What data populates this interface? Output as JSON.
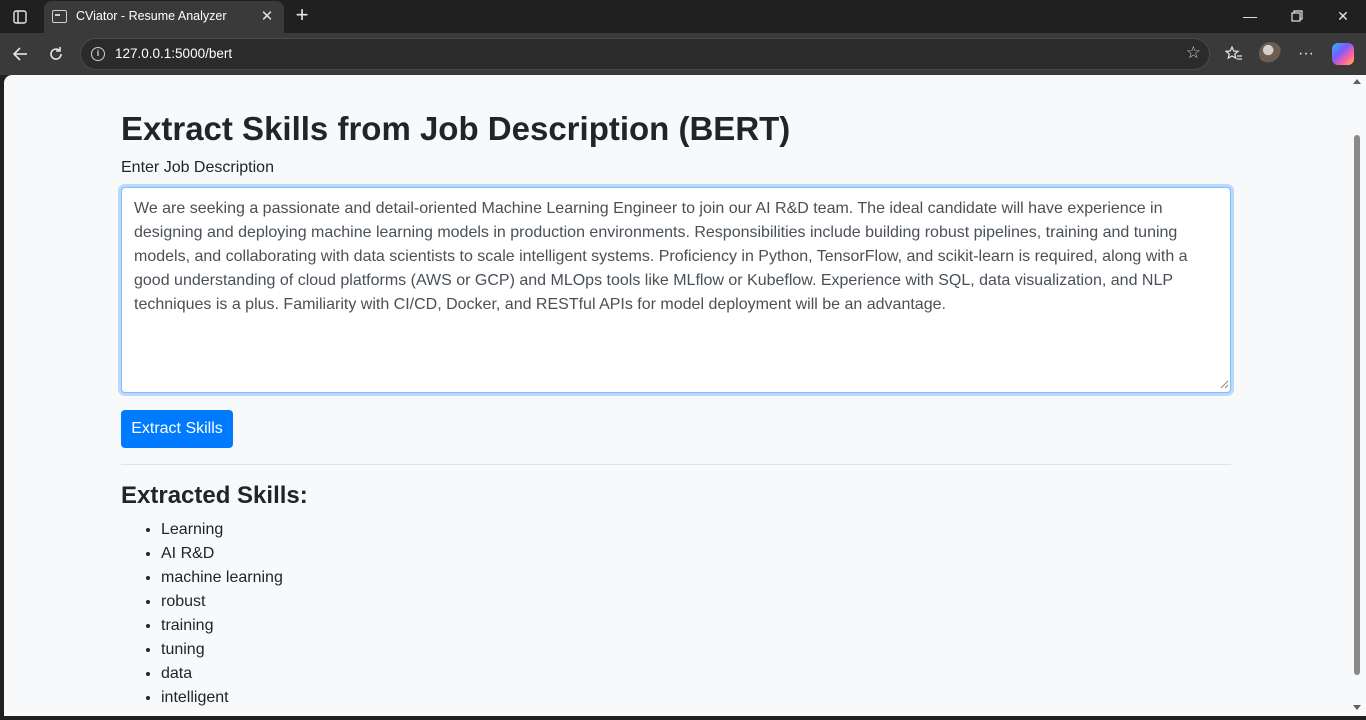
{
  "browser": {
    "tab_title": "CViator - Resume Analyzer",
    "url": "127.0.0.1:5000/bert",
    "new_tab_symbol": "+",
    "icons": [
      "tab-actions-icon",
      "page-favicon",
      "close-icon",
      "plus-icon",
      "minimize-icon",
      "restore-icon",
      "close-window-icon",
      "back-arrow-icon",
      "refresh-icon",
      "site-info-icon",
      "star-icon",
      "favorites-icon",
      "profile-avatar",
      "more-icon",
      "copilot-icon"
    ]
  },
  "page": {
    "heading": "Extract Skills from Job Description (BERT)",
    "input_label": "Enter Job Description",
    "job_description": "We are seeking a passionate and detail-oriented Machine Learning Engineer to join our AI R&D team. The ideal candidate will have experience in designing and deploying machine learning models in production environments. Responsibilities include building robust pipelines, training and tuning models, and collaborating with data scientists to scale intelligent systems. Proficiency in Python, TensorFlow, and scikit-learn is required, along with a good understanding of cloud platforms (AWS or GCP) and MLOps tools like MLflow or Kubeflow. Experience with SQL, data visualization, and NLP techniques is a plus. Familiarity with CI/CD, Docker, and RESTful APIs for model deployment will be an advantage.",
    "submit_label": "Extract Skills",
    "results_heading": "Extracted Skills:",
    "skills": [
      "Learning",
      "AI R&D",
      "machine learning",
      "robust",
      "training",
      "tuning",
      "data",
      "intelligent"
    ],
    "colors": {
      "primary_button": "#007bff",
      "page_background": "#f8f9fa",
      "focus_border": "#80bdff",
      "text": "#212529"
    }
  }
}
